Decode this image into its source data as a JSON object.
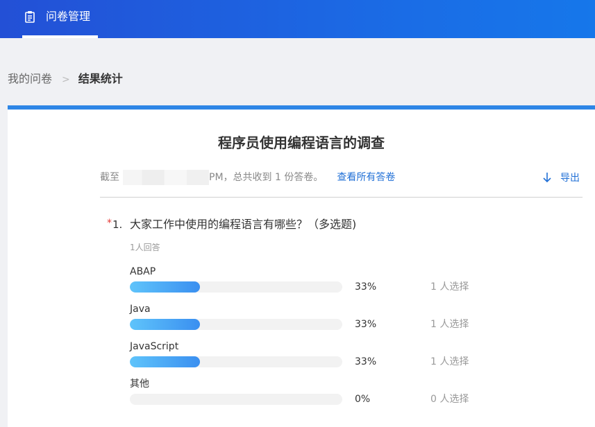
{
  "header": {
    "nav_tab_label": "问卷管理",
    "icon": "clipboard-icon"
  },
  "breadcrumb": {
    "parent": "我的问卷",
    "separator": ">",
    "current": "结果统计"
  },
  "survey": {
    "title": "程序员使用编程语言的调查",
    "meta_prefix": "截至",
    "meta_suffix": "PM，总共收到 1 份答卷。",
    "view_all_label": "查看所有答卷",
    "export_label": "导出"
  },
  "question": {
    "required_mark": "*",
    "number": "1.",
    "text": "大家工作中使用的编程语言有哪些？（多选题)",
    "answer_count": "1人回答",
    "options": [
      {
        "label": "ABAP",
        "percent": "33%",
        "fraction": 0.33,
        "count_text": "1 人选择"
      },
      {
        "label": "Java",
        "percent": "33%",
        "fraction": 0.33,
        "count_text": "1 人选择"
      },
      {
        "label": "JavaScript",
        "percent": "33%",
        "fraction": 0.33,
        "count_text": "1 人选择"
      },
      {
        "label": "其他",
        "percent": "0%",
        "fraction": 0,
        "count_text": "0 人选择"
      }
    ]
  },
  "colors": {
    "header_gradient_start": "#2350d6",
    "header_gradient_end": "#1677ea",
    "accent": "#1f6fd6",
    "bar_fill_start": "#5fc4fb",
    "bar_fill_end": "#3a8ff0",
    "required": "#e53935"
  }
}
